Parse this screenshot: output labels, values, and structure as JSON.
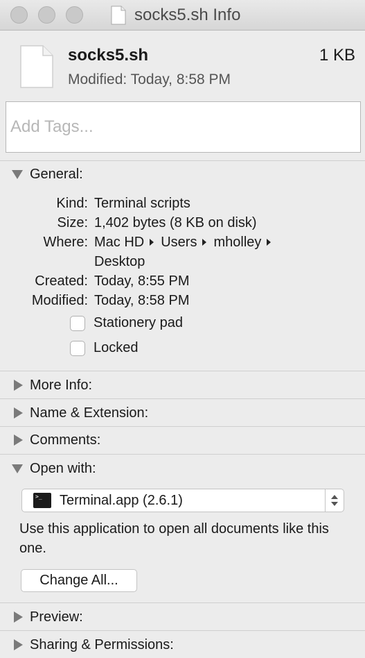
{
  "window": {
    "title": "socks5.sh Info"
  },
  "header": {
    "file_name": "socks5.sh",
    "file_size": "1 KB",
    "modified": "Modified: Today, 8:58 PM"
  },
  "tags": {
    "placeholder": "Add Tags..."
  },
  "general": {
    "label": "General:",
    "expanded": true,
    "kind_label": "Kind:",
    "kind_value": "Terminal scripts",
    "size_label": "Size:",
    "size_value": "1,402 bytes (8 KB on disk)",
    "where_label": "Where:",
    "where_path": [
      "Mac HD",
      "Users",
      "mholley"
    ],
    "where_last": "Desktop",
    "created_label": "Created:",
    "created_value": "Today, 8:55 PM",
    "modified_label": "Modified:",
    "modified_value": "Today, 8:58 PM",
    "stationery_label": "Stationery pad",
    "stationery_checked": false,
    "locked_label": "Locked",
    "locked_checked": false
  },
  "sections": {
    "more_info": "More Info:",
    "name_extension": "Name & Extension:",
    "comments": "Comments:",
    "open_with": "Open with:",
    "preview": "Preview:",
    "sharing": "Sharing & Permissions:"
  },
  "open_with": {
    "app": "Terminal.app (2.6.1)",
    "help": "Use this application to open all documents like this one.",
    "change_all": "Change All..."
  },
  "icons": {
    "document": "document-icon",
    "terminal": "terminal-icon"
  }
}
